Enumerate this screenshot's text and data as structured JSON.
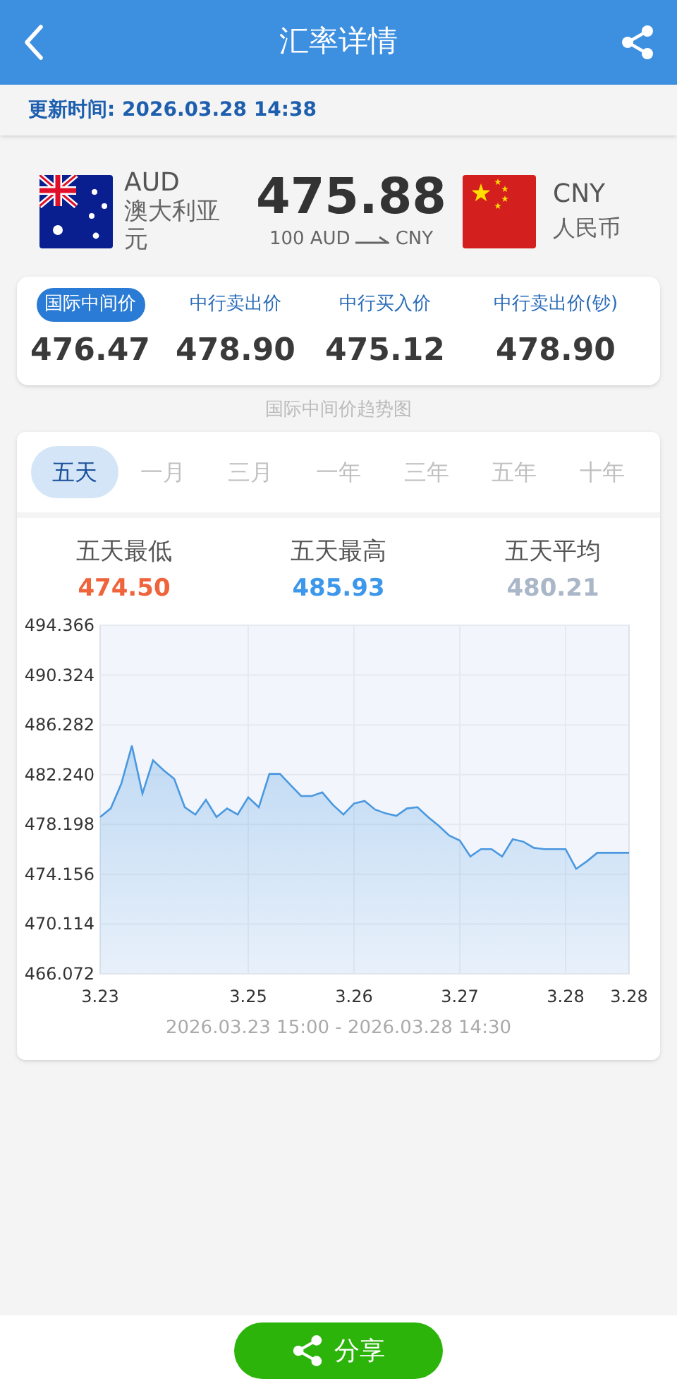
{
  "header": {
    "title": "汇率详情"
  },
  "update_time": "更新时间: 2026.03.28 14:38",
  "conversion": {
    "from": {
      "code": "AUD",
      "name": "澳大利亚元"
    },
    "rate": "475.88",
    "amount": "100 AUD",
    "target": "CNY",
    "to": {
      "code": "CNY",
      "name": "人民币"
    }
  },
  "rates": [
    {
      "label": "国际中间价",
      "value": "476.47",
      "selected": true
    },
    {
      "label": "中行卖出价",
      "value": "478.90",
      "selected": false
    },
    {
      "label": "中行买入价",
      "value": "475.12",
      "selected": false
    },
    {
      "label": "中行卖出价(钞)",
      "value": "478.90",
      "selected": false
    }
  ],
  "chart_title": "国际中间价趋势图",
  "periods": [
    {
      "label": "五天",
      "selected": true
    },
    {
      "label": "一月",
      "selected": false
    },
    {
      "label": "三月",
      "selected": false
    },
    {
      "label": "一年",
      "selected": false
    },
    {
      "label": "三年",
      "selected": false
    },
    {
      "label": "五年",
      "selected": false
    },
    {
      "label": "十年",
      "selected": false
    }
  ],
  "stats": [
    {
      "label": "五天最低",
      "value": "474.50",
      "color": "#f0643c"
    },
    {
      "label": "五天最高",
      "value": "485.93",
      "color": "#3d97ea"
    },
    {
      "label": "五天平均",
      "value": "480.21",
      "color": "#a9b7c8"
    }
  ],
  "chart_data": {
    "type": "area",
    "grid": true,
    "ylim": [
      466.072,
      494.366
    ],
    "categories": [
      "3.23",
      null,
      null,
      null,
      null,
      null,
      null,
      null,
      null,
      null,
      null,
      null,
      null,
      null,
      "3.25",
      null,
      null,
      null,
      null,
      null,
      null,
      null,
      null,
      null,
      "3.26",
      null,
      null,
      null,
      null,
      null,
      null,
      null,
      null,
      null,
      "3.27",
      null,
      null,
      null,
      null,
      null,
      null,
      null,
      null,
      null,
      "3.28",
      null,
      null,
      null,
      null,
      null,
      "3.28"
    ],
    "yticks": [
      {
        "value": 494.366,
        "label": "494.366"
      },
      {
        "value": 490.324,
        "label": "490.324"
      },
      {
        "value": 486.282,
        "label": "486.282"
      },
      {
        "value": 482.24,
        "label": "482.240"
      },
      {
        "value": 478.198,
        "label": "478.198"
      },
      {
        "value": 474.156,
        "label": "474.156"
      },
      {
        "value": 470.114,
        "label": "470.114"
      },
      {
        "value": 466.072,
        "label": "466.072"
      }
    ],
    "series": [
      {
        "color": "#4a98e0",
        "values": [
          478.8,
          479.5,
          481.5,
          484.6,
          480.7,
          483.4,
          482.6,
          481.9,
          479.6,
          479.0,
          480.2,
          478.8,
          479.5,
          479.0,
          480.4,
          479.6,
          482.3,
          482.3,
          481.4,
          480.5,
          480.5,
          480.8,
          479.8,
          479.0,
          479.9,
          480.1,
          479.4,
          479.1,
          478.9,
          479.5,
          479.6,
          478.8,
          478.1,
          477.3,
          476.9,
          475.6,
          476.2,
          476.2,
          475.6,
          477.0,
          476.8,
          476.3,
          476.2,
          476.2,
          476.2,
          474.6,
          475.2,
          475.9,
          475.9,
          475.9,
          475.9
        ]
      }
    ]
  },
  "range": "2026.03.23 15:00 - 2026.03.28 14:30",
  "share_button": "分享"
}
